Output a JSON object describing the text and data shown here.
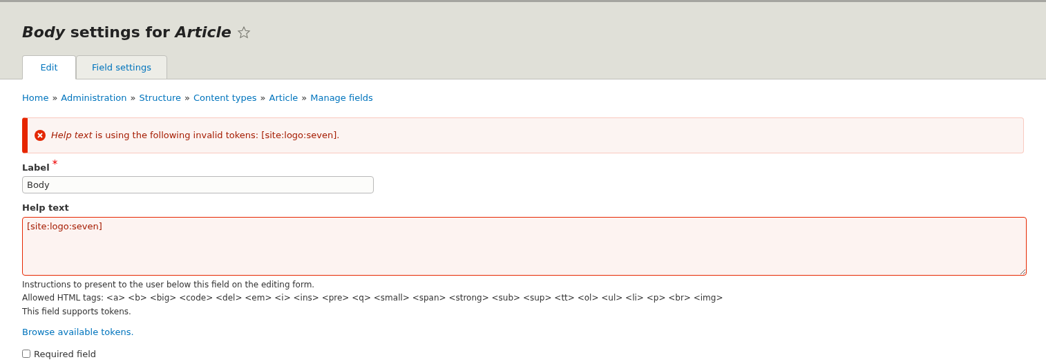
{
  "page_title": "*Body* settings for *Article*",
  "tabs": [
    {
      "label": "Edit",
      "selected": true
    },
    {
      "label": "Field settings",
      "selected": false
    }
  ],
  "breadcrumb": [
    "Home",
    "Administration",
    "Structure",
    "Content types",
    "Article",
    "Manage fields"
  ],
  "breadcrumb_separator": "»",
  "error_message": "*Help text* is using the following invalid tokens: [site:logo:seven].",
  "label_field": {
    "label": "Label",
    "required_mark": "*",
    "value": "Body"
  },
  "help_text_field": {
    "label": "Help text",
    "value": "[site:logo:seven]",
    "error": true
  },
  "description": [
    "Instructions to present to the user below this field on the editing form.",
    "Allowed HTML tags: <a> <b> <big> <code> <del> <em> <i> <ins> <pre> <q> <small> <span> <strong> <sub> <sup> <tt> <ol> <ul> <li> <p> <br> <img>",
    "This field supports tokens."
  ],
  "browse_link": "Browse available tokens.",
  "required_checkbox": {
    "label": "Required field",
    "checked": false
  }
}
